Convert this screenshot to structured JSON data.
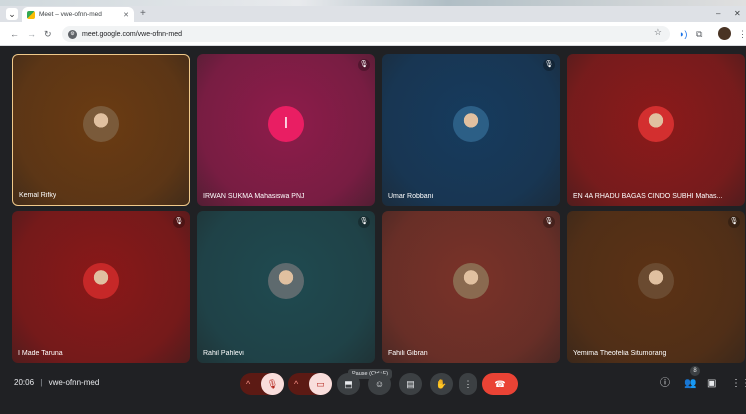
{
  "browser": {
    "tab_title": "Meet – vwe-ofnn-med",
    "tab_close": "✕",
    "new_tab": "+",
    "url": "meet.google.com/vwe-ofnn-med",
    "nav": {
      "back": "←",
      "forward": "→",
      "reload": "↻"
    },
    "window_controls": {
      "minimize": "–",
      "close": "✕"
    },
    "star": "☆",
    "tab_menu": "⌄"
  },
  "participants": [
    {
      "name": "Kemal Rifky",
      "muted": false,
      "bg": "#6b3b12",
      "avatar_color": "#7a5a3a"
    },
    {
      "name": "IRWAN SUKMA Mahasiswa PNJ",
      "muted": true,
      "bg": "#8e1c4a",
      "letter": "I"
    },
    {
      "name": "Umar Robbani",
      "muted": true,
      "bg": "#163b5e",
      "avatar_color": "#2c5f86"
    },
    {
      "name": "EN 4A RHADU BAGAS CINDO SUBHI Mahas...",
      "muted": false,
      "bg": "#8c1a1a",
      "avatar_color": "#d32f2f"
    },
    {
      "name": "I Made Taruna",
      "muted": true,
      "bg": "#8a1818",
      "avatar_color": "#c62828"
    },
    {
      "name": "Rahil Pahlevi",
      "muted": true,
      "bg": "#1f4a50",
      "avatar_color": "#5e6a6e"
    },
    {
      "name": "Fahili Gibran",
      "muted": true,
      "bg": "#7a3228",
      "avatar_color": "#8a6a50"
    },
    {
      "name": "Yemima Theofelia Situmorang",
      "muted": true,
      "bg": "#5c3214",
      "avatar_color": "#6a4a30"
    }
  ],
  "controls": {
    "time": "20:06",
    "separator": "|",
    "meeting_code": "vwe-ofnn-med",
    "tooltip": "Pause (Ctrl+F)",
    "participants_count": "8"
  }
}
